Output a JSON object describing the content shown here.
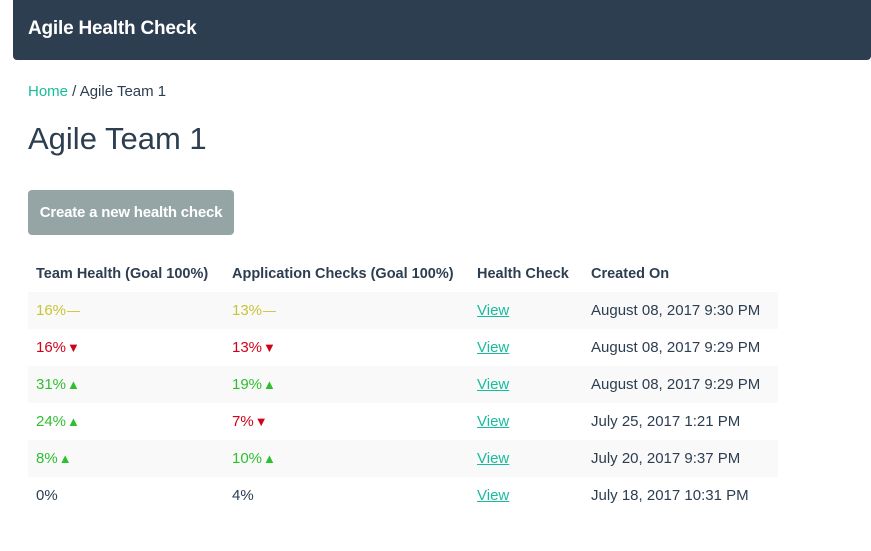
{
  "navbar": {
    "brand": "Agile Health Check"
  },
  "breadcrumb": {
    "home": "Home",
    "separator": " / ",
    "current": "Agile Team 1"
  },
  "page": {
    "title": "Agile Team 1"
  },
  "actions": {
    "create_label": "Create a new health check"
  },
  "colors": {
    "navbar_bg": "#2c3e50",
    "link": "#18bc9c",
    "button_bg": "#95a5a6",
    "flat": "#c9c336",
    "down": "#d0021b",
    "up": "#2ebf2e"
  },
  "table": {
    "headers": [
      "Team Health (Goal 100%)",
      "Application Checks (Goal 100%)",
      "Health Check",
      "Created On"
    ],
    "rows": [
      {
        "team": "16%",
        "team_trend": "—",
        "team_status": "flat",
        "app": "13%",
        "app_trend": "—",
        "app_status": "flat",
        "link": "View",
        "created": "August 08, 2017 9:30 PM"
      },
      {
        "team": "16%",
        "team_trend": "▼",
        "team_status": "down",
        "app": "13%",
        "app_trend": "▼",
        "app_status": "down",
        "link": "View",
        "created": "August 08, 2017 9:29 PM"
      },
      {
        "team": "31%",
        "team_trend": "▲",
        "team_status": "up",
        "app": "19%",
        "app_trend": "▲",
        "app_status": "up",
        "link": "View",
        "created": "August 08, 2017 9:29 PM"
      },
      {
        "team": "24%",
        "team_trend": "▲",
        "team_status": "up",
        "app": "7%",
        "app_trend": "▼",
        "app_status": "down",
        "link": "View",
        "created": "July 25, 2017 1:21 PM"
      },
      {
        "team": "8%",
        "team_trend": "▲",
        "team_status": "up",
        "app": "10%",
        "app_trend": "▲",
        "app_status": "up",
        "link": "View",
        "created": "July 20, 2017 9:37 PM"
      },
      {
        "team": "0%",
        "team_trend": "",
        "team_status": "none",
        "app": "4%",
        "app_trend": "",
        "app_status": "none",
        "link": "View",
        "created": "July 18, 2017 10:31 PM"
      }
    ]
  }
}
